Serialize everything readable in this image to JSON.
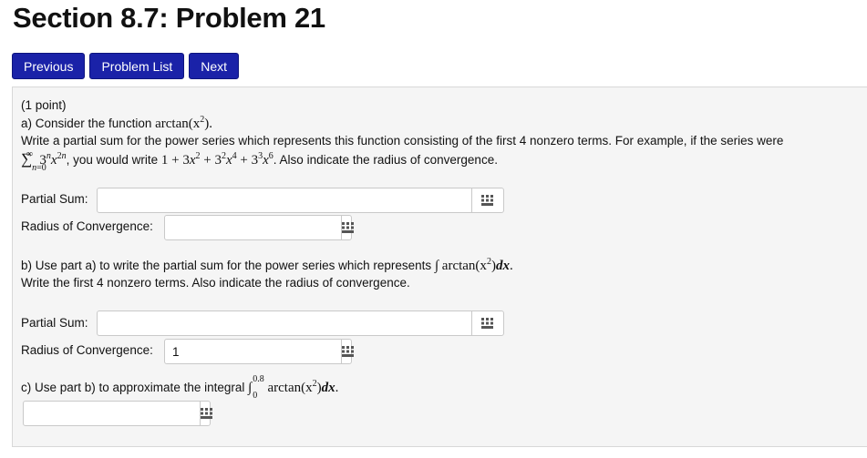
{
  "page": {
    "title": "Section 8.7: Problem 21"
  },
  "nav": {
    "previous": "Previous",
    "problem_list": "Problem List",
    "next": "Next"
  },
  "problem": {
    "points": "(1 point)",
    "part_a": {
      "intro_prefix": "a) Consider the function ",
      "function": "arctan(x",
      "instructions": "Write a partial sum for the power series which represents this function consisting of the first 4 nonzero terms. For example, if the series were",
      "example_series": "3",
      "example_mid": ", you would write ",
      "example_suffix": ". Also indicate the radius of convergence.",
      "partial_sum_label": "Partial Sum:",
      "partial_sum_value": "",
      "radius_label": "Radius of Convergence:",
      "radius_value": ""
    },
    "part_b": {
      "intro": "b) Use part a) to write the partial sum for the power series which represents ",
      "integral": "arctan(x",
      "instructions": "Write the first 4 nonzero terms. Also indicate the radius of convergence.",
      "partial_sum_label": "Partial Sum:",
      "partial_sum_value": "",
      "radius_label": "Radius of Convergence:",
      "radius_value": "1"
    },
    "part_c": {
      "intro": "c) Use part b) to approximate the integral ",
      "upper_limit": "0.8",
      "lower_limit": "0",
      "integrand": "arctan(x",
      "answer_value": ""
    }
  },
  "icons": {
    "keyboard": "keypad-icon"
  }
}
